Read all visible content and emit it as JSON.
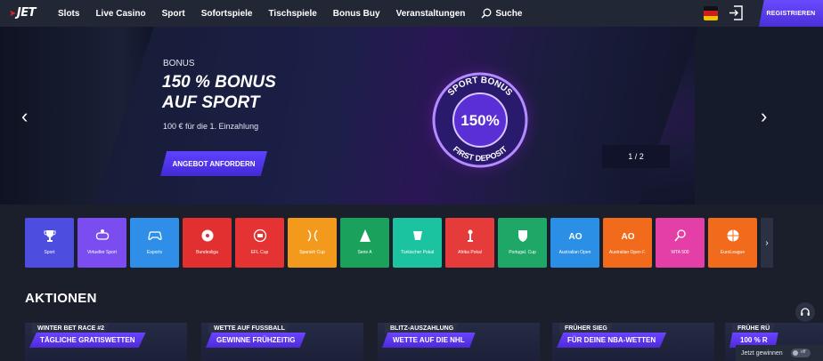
{
  "header": {
    "logo": "JET",
    "nav": [
      "Slots",
      "Live Casino",
      "Sport",
      "Sofortspiele",
      "Tischspiele",
      "Bonus Buy",
      "Veranstaltungen"
    ],
    "search_label": "Suche",
    "register_label": "REGISTRIEREN"
  },
  "hero": {
    "bonus_label": "BONUS",
    "title_line1": "150 % BONUS",
    "title_line2": "AUF SPORT",
    "subtitle": "100 € für die 1. Einzahlung",
    "cta_label": "ANGEBOT ANFORDERN",
    "medal_top": "SPORT BONUS",
    "medal_value": "150%",
    "medal_bottom": "FIRST DEPOSIT",
    "counter": "1 / 2"
  },
  "categories": [
    {
      "label": "Sport",
      "color": "#4d4de0"
    },
    {
      "label": "Virtueller Sport",
      "color": "#7b4df0"
    },
    {
      "label": "Esports",
      "color": "#2f8fe8"
    },
    {
      "label": "Bundesliga",
      "color": "#e23030"
    },
    {
      "label": "EFL Cup",
      "color": "#e53232"
    },
    {
      "label": "Spanish Cup",
      "color": "#f39a1c"
    },
    {
      "label": "Serie A",
      "color": "#1aa25c"
    },
    {
      "label": "Türkischer Pokal",
      "color": "#1cc3a0"
    },
    {
      "label": "Afrika Pokal",
      "color": "#e63b3b"
    },
    {
      "label": "Portugal. Cup",
      "color": "#1ea766"
    },
    {
      "label": "Australian Open",
      "color": "#2c8fe6"
    },
    {
      "label": "Australian Open F.",
      "color": "#f26b1d"
    },
    {
      "label": "WTA 500",
      "color": "#e43fa6"
    },
    {
      "label": "EuroLeague",
      "color": "#f26b1d"
    }
  ],
  "promotions": {
    "title": "AKTIONEN",
    "items": [
      {
        "head": "WINTER BET RACE #2",
        "tag": "TÄGLICHE GRATISWETTEN"
      },
      {
        "head": "WETTE AUF FUSSBALL",
        "tag": "GEWINNE FRÜHZEITIG"
      },
      {
        "head": "BLITZ-AUSZAHLUNG",
        "tag": "WETTE AUF DIE NHL"
      },
      {
        "head": "FRÜHER SIEG",
        "tag": "FÜR DEINE NBA-WETTEN"
      },
      {
        "head": "FRÜHE RÜ",
        "tag": "100 % R"
      }
    ]
  },
  "win_toggle_label": "Jetzt gewinnen",
  "toggle_label": "off"
}
